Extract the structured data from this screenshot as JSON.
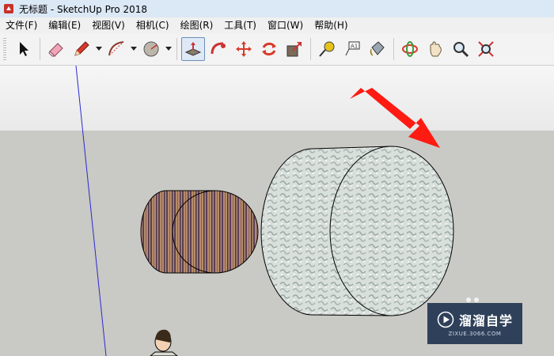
{
  "window": {
    "title": "无标题 - SketchUp Pro 2018"
  },
  "menu": [
    {
      "label": "文件(F)"
    },
    {
      "label": "编辑(E)"
    },
    {
      "label": "视图(V)"
    },
    {
      "label": "相机(C)"
    },
    {
      "label": "绘图(R)"
    },
    {
      "label": "工具(T)"
    },
    {
      "label": "窗口(W)"
    },
    {
      "label": "帮助(H)"
    }
  ],
  "toolbar": {
    "tools": [
      "select",
      "eraser",
      "pencil-line",
      "arc",
      "circle",
      "push-pull",
      "follow-me",
      "move",
      "rotate",
      "scale",
      "tape-measure",
      "text",
      "paint-bucket",
      "orbit",
      "pan",
      "zoom",
      "zoom-extents"
    ],
    "active": "push-pull"
  },
  "watermark": {
    "title": "溜溜自学",
    "subtitle": "ZIXUE.3066.COM"
  },
  "colors": {
    "titlebar": "#dbe8f6",
    "ground": "#c9c9c5",
    "arrow": "#ff1a12"
  }
}
